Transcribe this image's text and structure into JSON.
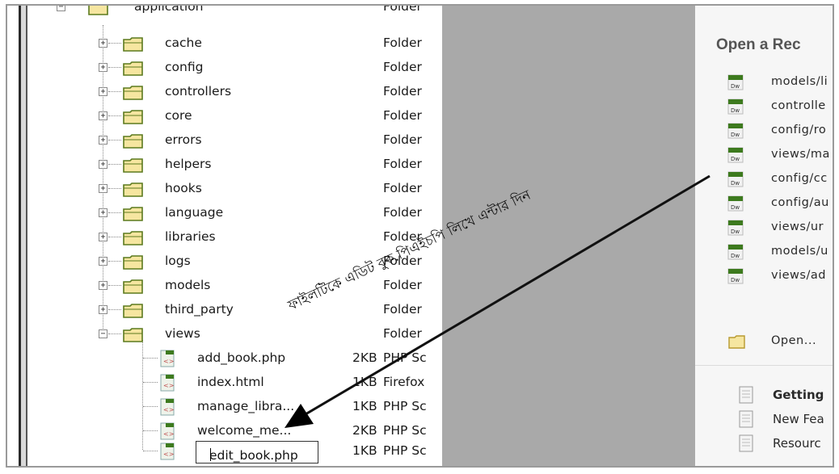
{
  "file_tree": {
    "partial_top_row": {
      "name": "application",
      "type": "Folder"
    },
    "folders": [
      {
        "name": "cache",
        "type": "Folder",
        "expander": "+"
      },
      {
        "name": "config",
        "type": "Folder",
        "expander": "+"
      },
      {
        "name": "controllers",
        "type": "Folder",
        "expander": "+"
      },
      {
        "name": "core",
        "type": "Folder",
        "expander": "+"
      },
      {
        "name": "errors",
        "type": "Folder",
        "expander": "+"
      },
      {
        "name": "helpers",
        "type": "Folder",
        "expander": "+"
      },
      {
        "name": "hooks",
        "type": "Folder",
        "expander": "+"
      },
      {
        "name": "language",
        "type": "Folder",
        "expander": "+"
      },
      {
        "name": "libraries",
        "type": "Folder",
        "expander": "+"
      },
      {
        "name": "logs",
        "type": "Folder",
        "expander": "+"
      },
      {
        "name": "models",
        "type": "Folder",
        "expander": "+"
      },
      {
        "name": "third_party",
        "type": "Folder",
        "expander": "+"
      },
      {
        "name": "views",
        "type": "Folder",
        "expander": "−"
      }
    ],
    "files": [
      {
        "name": "add_book.php",
        "size": "2KB",
        "type": "PHP Sc"
      },
      {
        "name": "index.html",
        "size": "1KB",
        "type": "Firefox"
      },
      {
        "name": "manage_libra...",
        "size": "1KB",
        "type": "PHP Sc"
      },
      {
        "name": "welcome_me...",
        "size": "2KB",
        "type": "PHP Sc"
      }
    ],
    "rename_field": {
      "value": "edit_book.php",
      "size": "1KB",
      "type": "PHP Sc"
    }
  },
  "start_panel": {
    "heading": "Open a Rec",
    "recent_files": [
      "models/li",
      "controlle",
      "config/ro",
      "views/ma",
      "config/cc",
      "config/au",
      "views/ur",
      "models/u",
      "views/ad"
    ],
    "open_label": "Open...",
    "links": [
      {
        "label": "Getting",
        "bold": true
      },
      {
        "label": "New Fea",
        "bold": false
      },
      {
        "label": "Resourc",
        "bold": false
      }
    ]
  },
  "annotation": {
    "text": "ফাইলটিকে এডিট বুক.পিএইচপি লিখে এন্টার দিন"
  },
  "colors": {
    "folder_fill": "#f6e6a0",
    "folder_stroke": "#5c7a1e",
    "dw_green": "#3d7a1e",
    "gray_panel": "#a9a9a9"
  }
}
